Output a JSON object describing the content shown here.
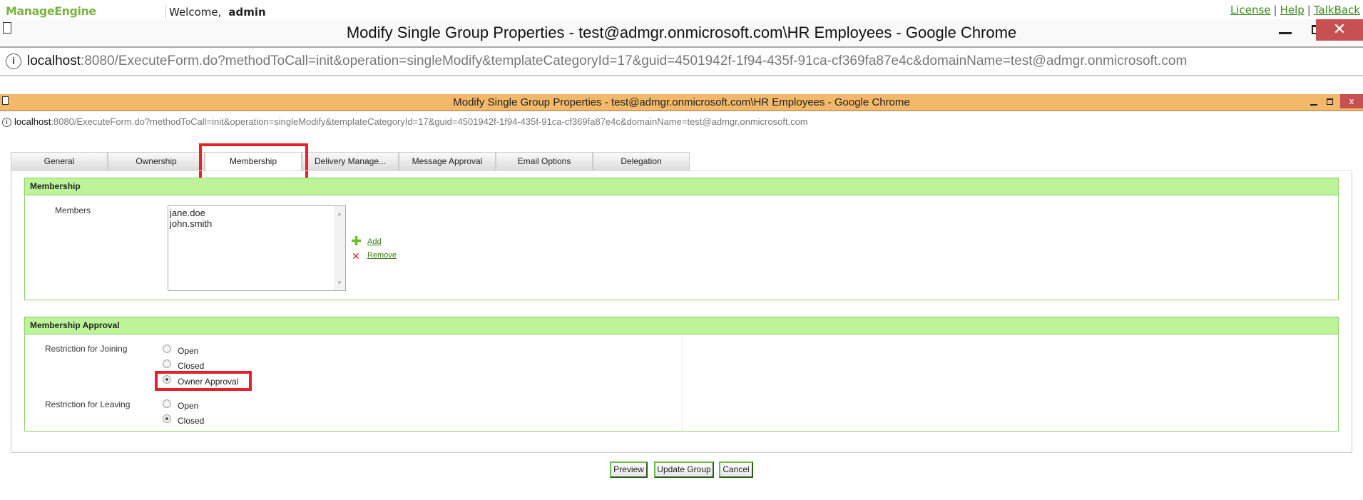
{
  "app": {
    "logo": "ManageEngine",
    "welcome": "Welcome,",
    "user": "admin",
    "links": [
      "License",
      "Help",
      "TalkBack"
    ]
  },
  "outer_window": {
    "title": "Modify Single Group Properties - test@admgr.onmicrosoft.com\\HR Employees - Google Chrome",
    "url_host": "localhost",
    "url_rest": ":8080/ExecuteForm.do?methodToCall=init&operation=singleModify&templateCategoryId=17&guid=4501942f-1f94-435f-91ca-cf369fa87e4c&domainName=test@admgr.onmicrosoft.com",
    "close": "✕"
  },
  "inner_window": {
    "title": "Modify Single Group Properties - test@admgr.onmicrosoft.com\\HR Employees - Google Chrome",
    "url_host": "localhost",
    "url_rest": ":8080/ExecuteForm.do?methodToCall=init&operation=singleModify&templateCategoryId=17&guid=4501942f-1f94-435f-91ca-cf369fa87e4c&domainName=test@admgr.onmicrosoft.com",
    "close": "x"
  },
  "tabs": [
    {
      "label": "General"
    },
    {
      "label": "Ownership"
    },
    {
      "label": "Membership",
      "active": true
    },
    {
      "label": "Delivery Manage..."
    },
    {
      "label": "Message Approval"
    },
    {
      "label": "Email Options"
    },
    {
      "label": "Delegation"
    }
  ],
  "membership": {
    "header": "Membership",
    "members_label": "Members",
    "members": [
      "jane.doe",
      "john.smith"
    ],
    "add": "Add",
    "remove": "Remove"
  },
  "approval": {
    "header": "Membership Approval",
    "joining_label": "Restriction for Joining",
    "joining_options": [
      "Open",
      "Closed",
      "Owner Approval"
    ],
    "joining_selected": "Owner Approval",
    "leaving_label": "Restriction for Leaving",
    "leaving_options": [
      "Open",
      "Closed"
    ],
    "leaving_selected": "Closed"
  },
  "buttons": {
    "preview": "Preview",
    "update": "Update Group",
    "cancel": "Cancel"
  },
  "colors": {
    "section_header": "#bdf49a",
    "highlight": "#e8202a",
    "chrome_inactive": "#f2b96a"
  }
}
